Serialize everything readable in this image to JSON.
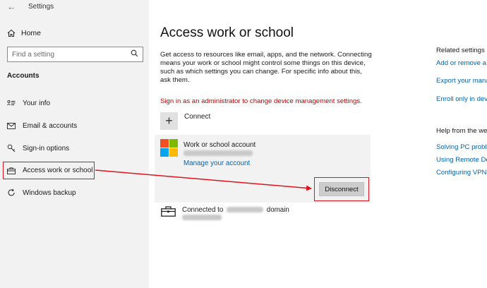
{
  "window": {
    "app_title": "Settings",
    "back_glyph": "←"
  },
  "sidebar": {
    "home_label": "Home",
    "search_placeholder": "Find a setting",
    "section_label": "Accounts",
    "items": [
      {
        "label": "Your info",
        "icon": "person-card-icon"
      },
      {
        "label": "Email & accounts",
        "icon": "mail-icon"
      },
      {
        "label": "Sign-in options",
        "icon": "key-icon"
      },
      {
        "label": "Access work or school",
        "icon": "briefcase-icon",
        "active": true
      },
      {
        "label": "Windows backup",
        "icon": "sync-icon"
      }
    ]
  },
  "main": {
    "title": "Access work or school",
    "description": "Get access to resources like email, apps, and the network. Connecting means your work or school might control some things on this device, such as which settings you can change. For specific info about this, ask them.",
    "admin_warning": "Sign in as an administrator to change device management settings.",
    "connect_label": "Connect",
    "account": {
      "name": "Work or school account",
      "manage_link": "Manage your account",
      "disconnect_label": "Disconnect"
    },
    "domain": {
      "prefix": "Connected to",
      "suffix": "domain"
    }
  },
  "right_panel": {
    "related_heading": "Related settings",
    "related_links": [
      "Add or remove a p",
      "Export your mana",
      "Enroll only in devi"
    ],
    "help_heading": "Help from the we",
    "help_links": [
      "Solving PC proble",
      "Using Remote De",
      "Configuring VPN"
    ]
  },
  "colors": {
    "accent_link": "#0063b1",
    "warning": "#c40000",
    "annotation_red": "#e0141e",
    "ms_red": "#f25022",
    "ms_green": "#7fba00",
    "ms_blue": "#00a4ef",
    "ms_yellow": "#ffb900"
  }
}
